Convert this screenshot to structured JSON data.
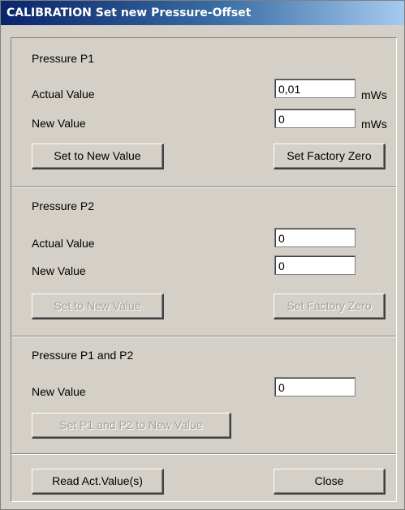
{
  "window": {
    "title": "CALIBRATION Set new Pressure-Offset"
  },
  "p1": {
    "heading": "Pressure P1",
    "actual_label": "Actual Value",
    "actual_value": "0,01",
    "new_label": "New Value",
    "new_value": "0",
    "unit": "mWs",
    "set_button": "Set to New Value",
    "factory_button": "Set Factory Zero"
  },
  "p2": {
    "heading": "Pressure P2",
    "actual_label": "Actual Value",
    "actual_value": "0",
    "new_label": "New Value",
    "new_value": "0",
    "set_button": "Set to New Value",
    "factory_button": "Set Factory Zero"
  },
  "p12": {
    "heading": "Pressure P1 and P2",
    "new_label": "New Value",
    "new_value": "0",
    "set_button": "Set P1 and P2 to New Value"
  },
  "footer": {
    "read_button": "Read Act.Value(s)",
    "close_button": "Close"
  }
}
